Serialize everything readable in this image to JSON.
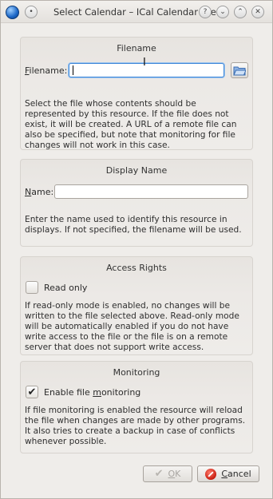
{
  "window": {
    "title": "Select Calendar – ICal Calendar File",
    "buttons": {
      "help": "?",
      "minimize": "⌄",
      "maximize": "⌃",
      "close": "✕",
      "keep_above": "•"
    }
  },
  "filename_group": {
    "title": "Filename",
    "field_label_prefix": "F",
    "field_label_rest": "ilename:",
    "value": "",
    "description": "Select the file whose contents should be represented by this resource. If the file does not exist, it will be created. A URL of a remote file can also be specified, but note that monitoring for file changes will not work in this case."
  },
  "display_name_group": {
    "title": "Display Name",
    "field_label_prefix": "N",
    "field_label_rest": "ame:",
    "value": "",
    "description": "Enter the name used to identify this resource in displays. If not specified, the filename will be used."
  },
  "access_rights_group": {
    "title": "Access Rights",
    "checkbox_label": "Read only",
    "checked": false,
    "description": "If read-only mode is enabled, no changes will be written to the file selected above. Read-only mode will be automatically enabled if you do not have write access to the file or the file is on a remote server that does not support write access."
  },
  "monitoring_group": {
    "title": "Monitoring",
    "checkbox_label_before": "Enable file ",
    "checkbox_label_underlined": "m",
    "checkbox_label_after": "onitoring",
    "checked": true,
    "description": "If file monitoring is enabled the resource will reload the file when changes are made by other programs. It also tries to create a backup in case of conflicts whenever possible."
  },
  "footer": {
    "ok_prefix": "O",
    "ok_rest": "K",
    "ok_enabled": false,
    "cancel_prefix": "C",
    "cancel_rest": "ancel"
  }
}
